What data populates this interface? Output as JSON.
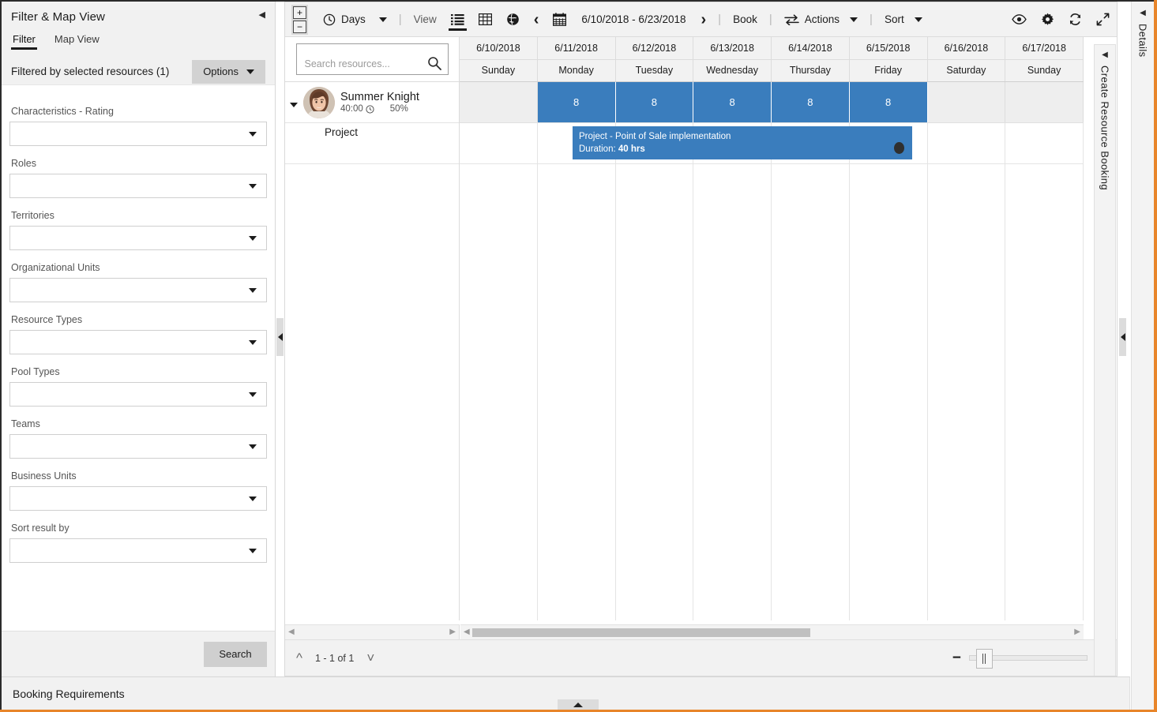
{
  "filter_panel": {
    "title": "Filter & Map View",
    "collapse_icon": "chevron-left-icon",
    "tabs": [
      {
        "label": "Filter",
        "active": true
      },
      {
        "label": "Map View",
        "active": false
      }
    ],
    "subbar": {
      "text": "Filtered by selected resources (1)",
      "options_label": "Options"
    },
    "fields": [
      {
        "label": "Characteristics - Rating",
        "value": ""
      },
      {
        "label": "Roles",
        "value": ""
      },
      {
        "label": "Territories",
        "value": ""
      },
      {
        "label": "Organizational Units",
        "value": ""
      },
      {
        "label": "Resource Types",
        "value": ""
      },
      {
        "label": "Pool Types",
        "value": ""
      },
      {
        "label": "Teams",
        "value": ""
      },
      {
        "label": "Business Units",
        "value": ""
      },
      {
        "label": "Sort result by",
        "value": ""
      }
    ],
    "search_button": "Search"
  },
  "toolbar": {
    "zoom_in": "+",
    "zoom_out": "−",
    "clock_icon": "clock-icon",
    "scale_label": "Days",
    "separator": "|",
    "view_label": "View",
    "view_list_icon": "list-view-icon",
    "view_grid_icon": "grid-view-icon",
    "view_map_icon": "map-view-icon",
    "prev_icon": "chevron-left-icon",
    "calendar_icon": "calendar-icon",
    "date_range": "6/10/2018 - 6/23/2018",
    "next_icon": "chevron-right-icon",
    "book_label": "Book",
    "actions_icon": "swap-arrows-icon",
    "actions_label": "Actions",
    "sort_label": "Sort",
    "eye_icon": "eye-icon",
    "gear_icon": "gear-icon",
    "refresh_icon": "refresh-icon",
    "expand_icon": "expand-diagonal-icon"
  },
  "resource_search": {
    "placeholder": "Search resources...",
    "value": "",
    "icon": "search-icon"
  },
  "schedule": {
    "columns": [
      {
        "date": "6/10/2018",
        "day": "Sunday"
      },
      {
        "date": "6/11/2018",
        "day": "Monday"
      },
      {
        "date": "6/12/2018",
        "day": "Tuesday"
      },
      {
        "date": "6/13/2018",
        "day": "Wednesday"
      },
      {
        "date": "6/14/2018",
        "day": "Thursday"
      },
      {
        "date": "6/15/2018",
        "day": "Friday"
      },
      {
        "date": "6/16/2018",
        "day": "Saturday"
      },
      {
        "date": "6/17/2018",
        "day": "Sunday"
      }
    ],
    "capacity_cells": [
      "",
      "8",
      "8",
      "8",
      "8",
      "8",
      "",
      ""
    ],
    "capacity_active_color": "#3a7dbd",
    "capacity_off_color": "#eeeeee",
    "booking": {
      "title": "Project - Point of Sale implementation",
      "duration_label": "Duration:",
      "duration_value": "40 hrs",
      "color": "#3a7dbd"
    }
  },
  "resources": [
    {
      "name": "Summer Knight",
      "hours": "40:00",
      "hours_icon": "clock-icon",
      "utilization": "50%",
      "expander_icon": "caret-down-icon",
      "avatar": "avatar",
      "child_label": "Project"
    }
  ],
  "board_footer": {
    "up_icon": "chevron-up-icon",
    "page_text": "1 - 1 of 1",
    "down_icon": "chevron-down-icon",
    "zoom_minus": "−",
    "zoom_plus": "+"
  },
  "rails": {
    "create_booking": {
      "label": "Create Resource Booking",
      "caret_icon": "chevron-left-icon"
    },
    "details": {
      "label": "Details",
      "caret_icon": "chevron-left-icon"
    }
  },
  "bottom_bar": {
    "label": "Booking Requirements"
  },
  "colors": {
    "accent_orange": "#e8852a",
    "blue": "#3a7dbd",
    "panel_grey": "#f1f1f1",
    "button_grey": "#d0d0d0"
  }
}
